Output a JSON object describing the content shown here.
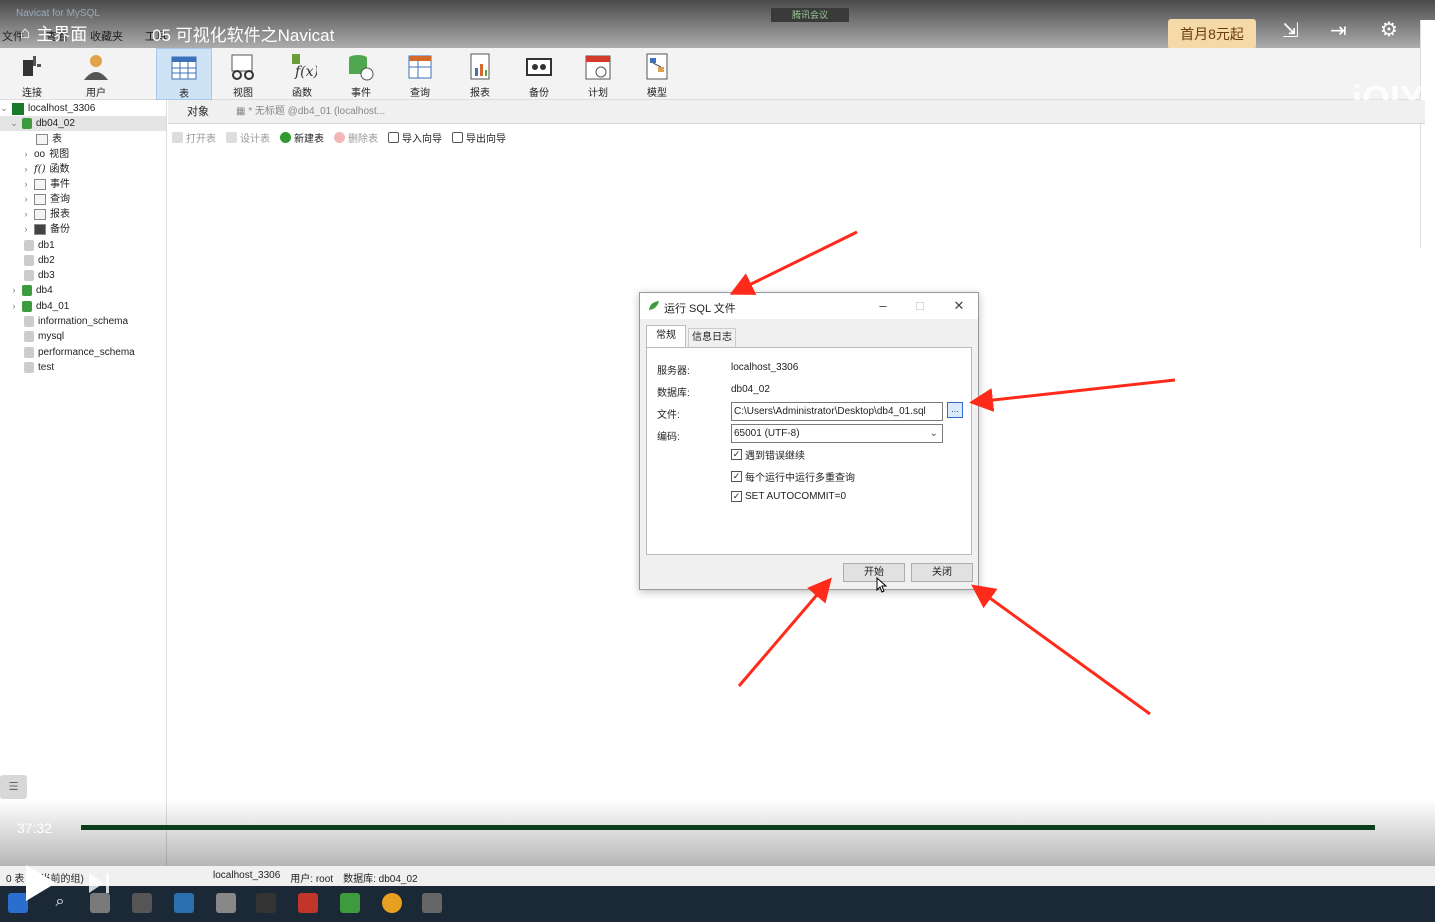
{
  "player": {
    "home_label": "主界面",
    "video_title": "05 可视化软件之Navicat",
    "promo": "首月8元起",
    "time": "37:32",
    "progress_fraction": 0.995,
    "watermark": "iQIY"
  },
  "app": {
    "title": "Navicat for MySQL",
    "meeting_badge": "腾讯会议",
    "menu": [
      "文件",
      "查看",
      "收藏夹",
      "工具"
    ]
  },
  "toolbar": {
    "connect": "连接",
    "user": "用户",
    "items": [
      "表",
      "视图",
      "函数",
      "事件",
      "查询",
      "报表",
      "备份",
      "计划",
      "模型"
    ]
  },
  "tree": {
    "connection": "localhost_3306",
    "selected_db": "db04_02",
    "children": [
      "表",
      "视图",
      "函数",
      "事件",
      "查询",
      "报表",
      "备份"
    ],
    "databases": [
      "db1",
      "db2",
      "db3",
      "db4",
      "db4_01",
      "information_schema",
      "mysql",
      "performance_schema",
      "test"
    ]
  },
  "objbar": {
    "objects_tab": "对象",
    "untitled_tab": "* 无标题 @db4_01 (localhost..."
  },
  "actions": {
    "open": "打开表",
    "design": "设计表",
    "new": "新建表",
    "delete": "删除表",
    "import": "导入向导",
    "export": "导出向导"
  },
  "dialog": {
    "title": "运行 SQL 文件",
    "tab_general": "常规",
    "tab_log": "信息日志",
    "server_label": "服务器:",
    "server_value": "localhost_3306",
    "db_label": "数据库:",
    "db_value": "db04_02",
    "file_label": "文件:",
    "file_value": "C:\\Users\\Administrator\\Desktop\\db4_01.sql",
    "encoding_label": "编码:",
    "encoding_value": "65001 (UTF-8)",
    "browse": "...",
    "check_continue": "遇到错误继续",
    "check_multi": "每个运行中运行多重查询",
    "check_autocommit": "SET AUTOCOMMIT=0",
    "start": "开始",
    "close": "关闭"
  },
  "status": {
    "left": "0 表 (在当前的组)",
    "connection": "localhost_3306",
    "user": "用户: root",
    "database": "数据库: db04_02"
  },
  "colors": {
    "accent_red": "#ff2a1a",
    "navicat_green": "#3d9a3d",
    "promo_bg": "#f5d9a8"
  }
}
